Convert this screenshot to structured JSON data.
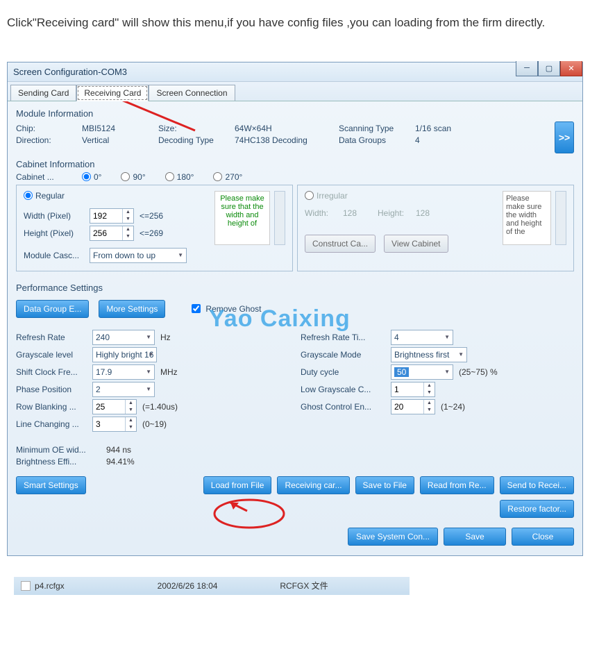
{
  "instruction": "Click\"Receiving card\" will show this menu,if you have config files ,you can loading from the firm directly.",
  "window_title": "Screen Configuration-COM3",
  "tabs": {
    "sending": "Sending Card",
    "receiving": "Receiving Card",
    "screen": "Screen Connection"
  },
  "module_info": {
    "header": "Module Information",
    "chip_label": "Chip:",
    "chip": "MBI5124",
    "size_label": "Size:",
    "size": "64W×64H",
    "scan_label": "Scanning Type",
    "scan": "1/16 scan",
    "dir_label": "Direction:",
    "dir": "Vertical",
    "decode_label": "Decoding Type",
    "decode": "74HC138 Decoding",
    "groups_label": "Data Groups",
    "groups": "4",
    "expand": ">>"
  },
  "cabinet": {
    "header": "Cabinet Information",
    "rotate_label": "Cabinet ...",
    "r0": "0°",
    "r90": "90°",
    "r180": "180°",
    "r270": "270°",
    "regular": "Regular",
    "irregular": "Irregular",
    "width_label": "Width (Pixel)",
    "width": "192",
    "width_hint": "<=256",
    "height_label": "Height (Pixel)",
    "height": "256",
    "height_hint": "<=269",
    "casc_label": "Module Casc...",
    "casc": "From down to up",
    "hint_green": "Please make sure that the width and height of",
    "irr_width_label": "Width:",
    "irr_width": "128",
    "irr_height_label": "Height:",
    "irr_height": "128",
    "construct": "Construct Ca...",
    "view": "View Cabinet",
    "hint_gray": "Please make sure the width and height of the"
  },
  "perf": {
    "header": "Performance Settings",
    "data_group": "Data Group E...",
    "more": "More Settings",
    "remove_ghost": "Remove Ghost",
    "refresh_label": "Refresh Rate",
    "refresh": "240",
    "refresh_unit": "Hz",
    "refresh_ti_label": "Refresh Rate Ti...",
    "refresh_ti": "4",
    "gray_label": "Grayscale level",
    "gray": "Highly bright 16",
    "gray_mode_label": "Grayscale Mode",
    "gray_mode": "Brightness first",
    "shift_label": "Shift Clock Fre...",
    "shift": "17.9",
    "shift_unit": "MHz",
    "duty_label": "Duty cycle",
    "duty": "50",
    "duty_unit": "(25~75) %",
    "phase_label": "Phase Position",
    "phase": "2",
    "lowg_label": "Low Grayscale C...",
    "lowg": "1",
    "rowb_label": "Row Blanking ...",
    "rowb": "25",
    "rowb_unit": "(=1.40us)",
    "ghost_label": "Ghost Control En...",
    "ghost": "20",
    "ghost_unit": "(1~24)",
    "line_label": "Line Changing ...",
    "line": "3",
    "line_unit": "(0~19)",
    "oe_label": "Minimum OE wid...",
    "oe": "944 ns",
    "bright_label": "Brightness Effi...",
    "bright": "94.41%"
  },
  "buttons": {
    "smart": "Smart Settings",
    "load": "Load from File",
    "recv": "Receiving car...",
    "savef": "Save to File",
    "read": "Read from Re...",
    "send": "Send to Recei...",
    "restore": "Restore factor...",
    "savesys": "Save System Con...",
    "save": "Save",
    "close": "Close"
  },
  "file": {
    "name": "p4.rcfgx",
    "date": "2002/6/26 18:04",
    "type": "RCFGX 文件"
  },
  "watermark": "Yao Caixing"
}
